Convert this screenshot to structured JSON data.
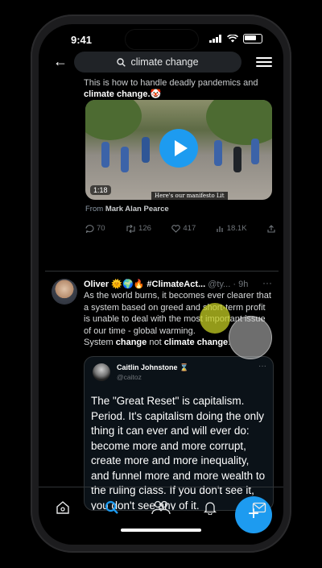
{
  "status": {
    "time": "9:41"
  },
  "search": {
    "query": "climate change",
    "back_icon": "back-arrow-icon",
    "filter_icon": "filter-sliders-icon"
  },
  "tweet1": {
    "text_plain": "This is how to handle deadly pandemics and",
    "text_bold": "climate change.",
    "emoji": "🤡",
    "video": {
      "duration": "1:18",
      "caption": "Here's our manifesto Lit"
    },
    "from_label": "From",
    "from_name": "Mark Alan Pearce",
    "replies": "70",
    "retweets": "126",
    "likes": "417",
    "views": "18.1K"
  },
  "tweet2": {
    "name": "Oliver",
    "name_emoji": "🌞🌍🔥",
    "hashtag": "#ClimateAct...",
    "handle": "@ty...",
    "time": "9h",
    "text_line1": "As the world burns, it becomes ever clearer that a system based on greed and short-term profit is unable to deal with the most important issue of our time - global warming.",
    "text_line2_a": "System",
    "text_line2_b": "change",
    "text_line2_c": "not",
    "text_line2_d": "climate change",
    "text_line2_e": ".",
    "quote": {
      "name": "Caitlin Johnstone",
      "name_emoji": "⌛",
      "handle": "@caitoz",
      "text": "The \"Great Reset\" is capitalism. Period. It's capitalism doing the only thing it can ever and will ever do: become more and more corrupt, create more and more inequality, and funnel more and more wealth to the ruling class. If you don't see it, you don't see any of it."
    }
  },
  "fab": {
    "label": "+"
  },
  "tabs": [
    "home-icon",
    "search-icon",
    "communities-icon",
    "notifications-icon",
    "messages-icon"
  ],
  "colors": {
    "accent": "#1d9bf0",
    "bg": "#000000",
    "touch_highlight": "#c4cd23"
  }
}
